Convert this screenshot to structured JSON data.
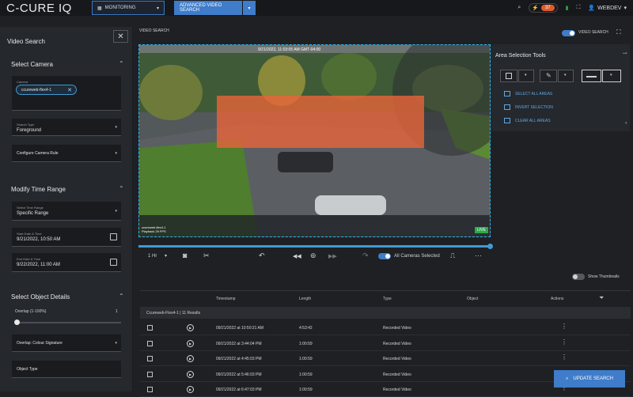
{
  "app": {
    "title": "C-CURE IQ"
  },
  "topbar": {
    "monitoring_label": "MONITORING",
    "advanced_label": "ADVANCED VIDEO SEARCH",
    "alarm_count": "37",
    "user": "WEBDEV"
  },
  "left_panel": {
    "title": "Video Search",
    "select_camera": {
      "heading": "Select Camera",
      "camera_label": "Camera",
      "camera_chip": "ccureweb-flex4-1",
      "search_type_label": "Search Type",
      "search_type_value": "Foreground",
      "configure_rule": "Configure Camera Rule"
    },
    "time_range": {
      "heading": "Modify Time Range",
      "range_label": "Select Time Range",
      "range_value": "Specific Range",
      "start_label": "Start Date & Time",
      "start_value": "9/21/2022, 10:50 AM",
      "end_label": "End Date & Time",
      "end_value": "9/22/2022, 11:00 AM"
    },
    "object_details": {
      "heading": "Select Object Details",
      "overlap_label": "Overlap (1-100%)",
      "overlap_value": "1",
      "overlap_fraction": 0.01,
      "signature": "Overlap: Colour Signature",
      "object_type": "Object Type"
    }
  },
  "video": {
    "header": "VIDEO SEARCH",
    "toggle_label": "VIDEO SEARCH",
    "timestamp": "9/21/2022, 11:03:05 AM GMT-04:00",
    "camera_name": "ccureweb-flex4-1",
    "playback": "Playback 29 FPS",
    "live": "LIVE",
    "speed": "1 Hr",
    "all_cameras": "All Cameras Selected",
    "progress_fraction": 1.0
  },
  "area_tools": {
    "title": "Area Selection Tools",
    "select_all": "SELECT ALL AREAS",
    "invert": "INVERT SELECTION",
    "clear_all": "CLEAR ALL AREAS"
  },
  "results": {
    "show_thumbnails": "Show Thumbnails",
    "headers": {
      "timestamp": "Timestamp",
      "length": "Length",
      "type": "Type",
      "object": "Object",
      "actions": "Actions"
    },
    "group": "Ccureweb-Flex4-1 | 11 Results",
    "rows": [
      {
        "timestamp": "09/21/2022 at 10:50:21 AM",
        "length": "4:53:42",
        "type": "Recorded Video"
      },
      {
        "timestamp": "09/21/2022 at 3:44:04 PM",
        "length": "1:00:59",
        "type": "Recorded Video"
      },
      {
        "timestamp": "09/21/2022 at 4:45:03 PM",
        "length": "1:00:59",
        "type": "Recorded Video"
      },
      {
        "timestamp": "09/21/2022 at 5:46:03 PM",
        "length": "1:00:59",
        "type": "Recorded Video"
      },
      {
        "timestamp": "09/21/2022 at 6:47:03 PM",
        "length": "1:00:59",
        "type": "Recorded Video"
      }
    ],
    "update_button": "UPDATE SEARCH"
  },
  "colors": {
    "accent": "#3f7cc9",
    "selection": "#e8643a",
    "live": "#2da84a",
    "alarm": "#e05a2a"
  }
}
